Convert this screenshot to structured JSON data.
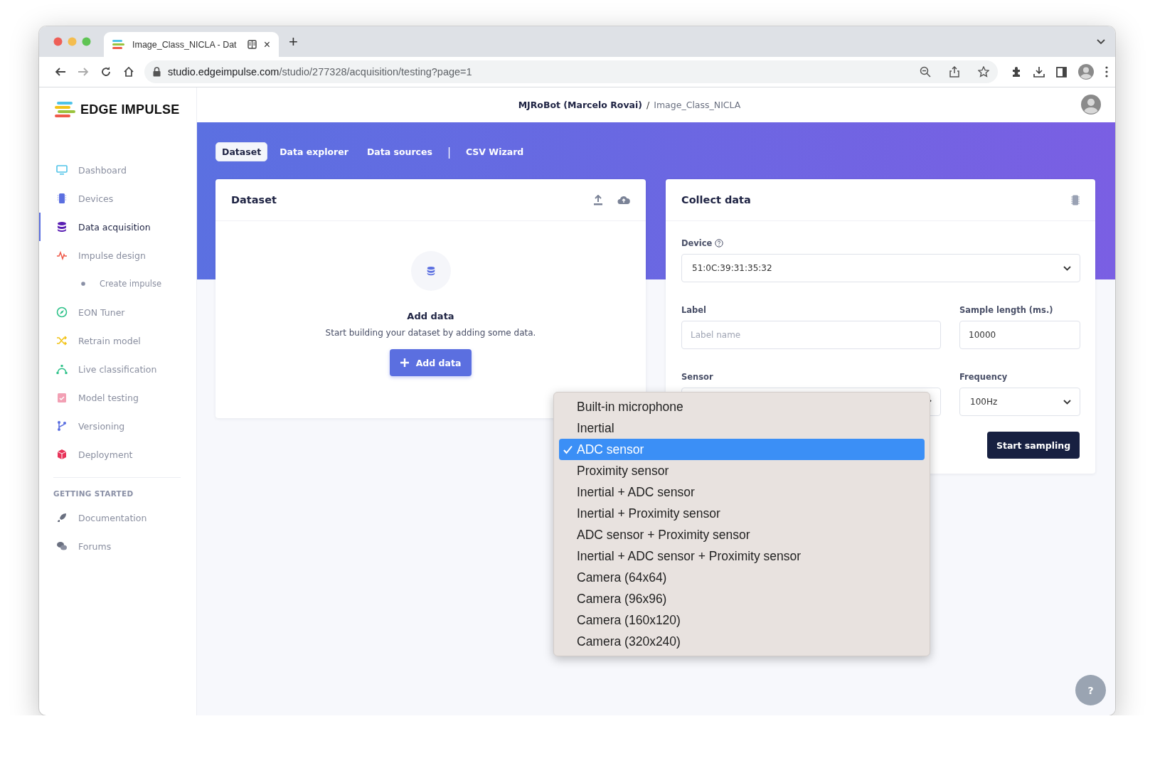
{
  "browser": {
    "tab": {
      "title": "Image_Class_NICLA - Dat",
      "close": "×"
    },
    "new_tab": "+",
    "url": {
      "host": "studio.edgeimpulse.com",
      "path": "/studio/277328/acquisition/testing?page=1"
    }
  },
  "sidebar": {
    "logo": "EDGE IMPULSE",
    "items": [
      {
        "label": "Dashboard",
        "kind": "monitor",
        "selected": false
      },
      {
        "label": "Devices",
        "kind": "chip",
        "selected": false
      },
      {
        "label": "Data acquisition",
        "kind": "database",
        "selected": true
      },
      {
        "label": "Impulse design",
        "kind": "pulse",
        "selected": false,
        "children": [
          {
            "label": "Create impulse",
            "kind": "dot",
            "selected": false
          }
        ]
      },
      {
        "label": "EON Tuner",
        "kind": "compass",
        "selected": false
      },
      {
        "label": "Retrain model",
        "kind": "shuffle",
        "selected": false
      },
      {
        "label": "Live classification",
        "kind": "curve",
        "selected": false
      },
      {
        "label": "Model testing",
        "kind": "clipboard",
        "selected": false
      },
      {
        "label": "Versioning",
        "kind": "branch",
        "selected": false
      },
      {
        "label": "Deployment",
        "kind": "cube",
        "selected": false
      }
    ],
    "section": "GETTING STARTED",
    "links": [
      {
        "label": "Documentation",
        "kind": "rocket",
        "selected": false
      },
      {
        "label": "Forums",
        "kind": "chat",
        "selected": false
      }
    ]
  },
  "header": {
    "owner": "MJRoBot (Marcelo Rovai)",
    "separator": "/",
    "project": "Image_Class_NICLA"
  },
  "tabs": [
    {
      "label": "Dataset",
      "kind": "tab",
      "selected": true
    },
    {
      "label": "Data explorer",
      "kind": "tab",
      "selected": false
    },
    {
      "label": "Data sources",
      "kind": "tab",
      "selected": false
    },
    {
      "label": "|",
      "kind": "separator"
    },
    {
      "label": "CSV Wizard",
      "kind": "tab",
      "selected": false
    }
  ],
  "dataset_card": {
    "title": "Dataset",
    "empty_title": "Add data",
    "empty_text": "Start building your dataset by adding some data.",
    "button": "Add data"
  },
  "collect_card": {
    "title": "Collect data",
    "device": {
      "label": "Device",
      "value": "51:0C:39:31:35:32"
    },
    "label": {
      "label": "Label",
      "placeholder": "Label name"
    },
    "sample_length": {
      "label": "Sample length (ms.)",
      "value": "10000"
    },
    "sensor": {
      "label": "Sensor"
    },
    "frequency": {
      "label": "Frequency",
      "value": "100Hz"
    },
    "button": "Start sampling"
  },
  "sensor_menu": {
    "options": [
      {
        "label": "Built-in microphone",
        "selected": false
      },
      {
        "label": "Inertial",
        "selected": false
      },
      {
        "label": "ADC sensor",
        "selected": true
      },
      {
        "label": "Proximity sensor",
        "selected": false
      },
      {
        "label": "Inertial + ADC sensor",
        "selected": false
      },
      {
        "label": "Inertial + Proximity sensor",
        "selected": false
      },
      {
        "label": "ADC sensor + Proximity sensor",
        "selected": false
      },
      {
        "label": "Inertial + ADC sensor + Proximity sensor",
        "selected": false
      },
      {
        "label": "Camera (64x64)",
        "selected": false
      },
      {
        "label": "Camera (96x96)",
        "selected": false
      },
      {
        "label": "Camera (160x120)",
        "selected": false
      },
      {
        "label": "Camera (320x240)",
        "selected": false
      }
    ]
  },
  "help_button": "?"
}
